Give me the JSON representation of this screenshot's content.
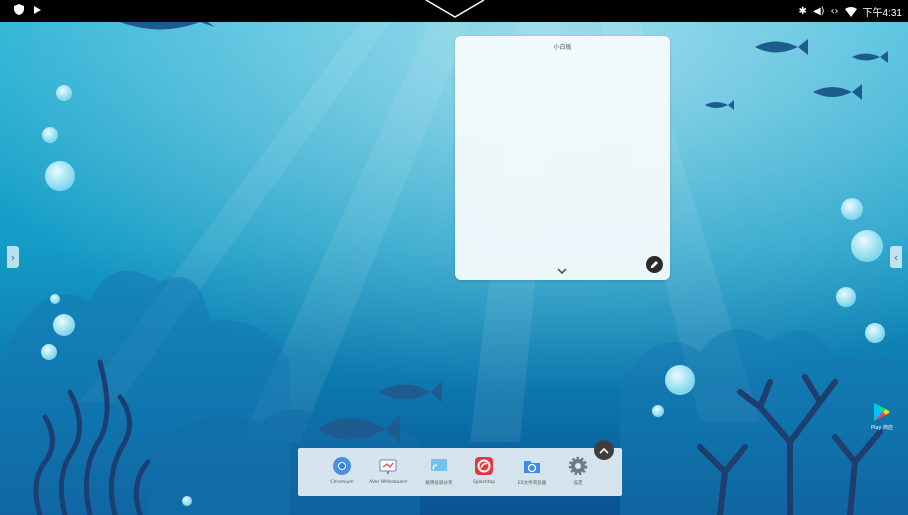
{
  "status_bar": {
    "time": "下午4:31",
    "left_icons": [
      "shield-icon",
      "play-icon"
    ],
    "right_icons": [
      "bluetooth-icon",
      "volume-icon",
      "ethernet-icon",
      "wifi-icon"
    ]
  },
  "widget": {
    "title": "小白板"
  },
  "dock": {
    "apps": [
      {
        "label": "Chromium",
        "icon": "chromium-icon"
      },
      {
        "label": "AVer Whiteboard",
        "icon": "whiteboard-icon"
      },
      {
        "label": "极简投屏分享",
        "icon": "screen-share-icon"
      },
      {
        "label": "Splashtop",
        "icon": "splashtop-icon"
      },
      {
        "label": "ES文件浏览器",
        "icon": "file-explorer-icon"
      },
      {
        "label": "设定",
        "icon": "settings-icon"
      }
    ]
  },
  "desktop": {
    "shortcuts": [
      {
        "label": "Play 商店",
        "icon": "play-store-icon"
      }
    ]
  },
  "colors": {
    "water_top": "#1fa6c9",
    "water_bottom": "#0a4f8c",
    "silhouette": "#1a4e7e",
    "coral": "#1e3d6b"
  }
}
